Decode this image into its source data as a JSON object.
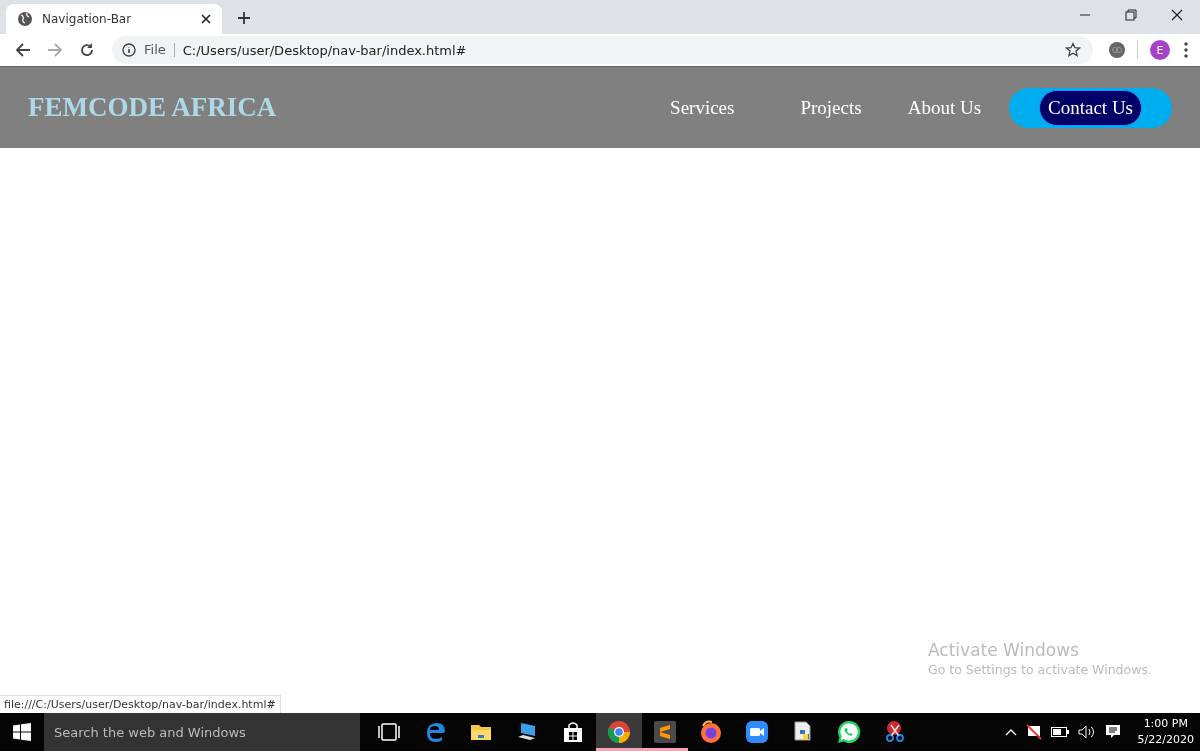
{
  "browser": {
    "tabs": [
      {
        "title": "Navigation-Bar",
        "selected": true
      }
    ],
    "address": {
      "scheme_label": "File",
      "url": "C:/Users/user/Desktop/nav-bar/index.html#"
    },
    "profile_initial": "E"
  },
  "page": {
    "logo": "FEMCODE AFRICA",
    "nav_links": [
      {
        "label": "Services",
        "kind": "link"
      },
      {
        "label": "Projects",
        "kind": "link"
      },
      {
        "label": "About Us",
        "kind": "link"
      },
      {
        "label": "Contact Us",
        "kind": "button"
      }
    ]
  },
  "status_url": "file:///C:/Users/user/Desktop/nav-bar/index.html#",
  "activation_notice": {
    "title": "Activate Windows",
    "message": "Go to Settings to activate Windows."
  },
  "taskbar": {
    "search_placeholder": "Search the web and Windows",
    "apps": [
      {
        "kind": "task-view",
        "running": false,
        "selected": false
      },
      {
        "kind": "edge",
        "running": false,
        "selected": false
      },
      {
        "kind": "folder",
        "running": false,
        "selected": false
      },
      {
        "kind": "computer",
        "running": false,
        "selected": false
      },
      {
        "kind": "store",
        "running": false,
        "selected": false
      },
      {
        "kind": "chrome",
        "running": true,
        "selected": true
      },
      {
        "kind": "sublime",
        "running": true,
        "selected": false
      },
      {
        "kind": "firefox",
        "running": false,
        "selected": false
      },
      {
        "kind": "zoom",
        "running": false,
        "selected": false
      },
      {
        "kind": "python",
        "running": false,
        "selected": false
      },
      {
        "kind": "whatsapp",
        "running": false,
        "selected": false
      },
      {
        "kind": "scissors",
        "running": false,
        "selected": false
      }
    ],
    "clock": {
      "time": "1:00 PM",
      "date": "5/22/2020"
    }
  }
}
